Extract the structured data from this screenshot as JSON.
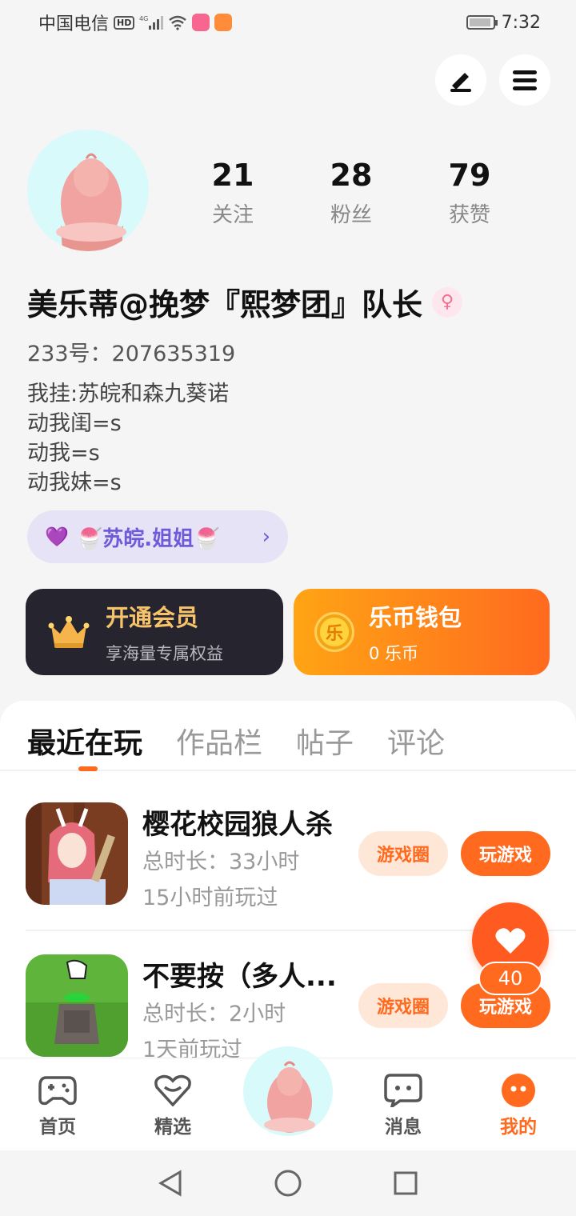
{
  "status_bar": {
    "carrier": "中国电信",
    "hd": "HD",
    "signal": "4G",
    "time": "7:32"
  },
  "profile": {
    "stats": [
      {
        "value": "21",
        "label": "关注"
      },
      {
        "value": "28",
        "label": "粉丝"
      },
      {
        "value": "79",
        "label": "获赞"
      }
    ],
    "username": "美乐蒂@挽梦『熙梦团』队长",
    "gender_symbol": "♀",
    "uid": "233号：207635319",
    "bio_lines": [
      "我挂:苏皖和森九葵诺",
      "动我闺=s",
      "动我=s",
      "动我妹=s"
    ],
    "couple": {
      "hearts": "💜",
      "name": "🍧苏皖.姐姐🍧",
      "chevron": "›"
    }
  },
  "cards": {
    "vip": {
      "title": "开通会员",
      "subtitle": "享海量专属权益"
    },
    "wallet": {
      "title": "乐币钱包",
      "subtitle": "0 乐币",
      "coin_char": "乐"
    }
  },
  "tabs": [
    {
      "label": "最近在玩",
      "active": true
    },
    {
      "label": "作品栏",
      "active": false
    },
    {
      "label": "帖子",
      "active": false
    },
    {
      "label": "评论",
      "active": false
    }
  ],
  "games": [
    {
      "name": "樱花校园狼人杀",
      "total_time": "总时长：33小时",
      "last_played": "15小时前玩过",
      "circle_label": "游戏圈",
      "play_label": "玩游戏"
    },
    {
      "name": "不要按（多人...",
      "total_time": "总时长：2小时",
      "last_played": "1天前玩过",
      "circle_label": "游戏圈",
      "play_label": "玩游戏"
    }
  ],
  "like_float": {
    "count": "40"
  },
  "bottom_nav": [
    {
      "label": "首页",
      "icon": "gamepad-icon",
      "active": false
    },
    {
      "label": "精选",
      "icon": "heart-chat-icon",
      "active": false
    },
    {
      "label": "消息",
      "icon": "message-icon",
      "active": false
    },
    {
      "label": "我的",
      "icon": "profile-face-icon",
      "active": true
    }
  ],
  "colors": {
    "accent": "#ff6a1f",
    "vip_gold": "#f6c36b",
    "couple_purple": "#6f5bd8",
    "avatar_bg": "#d9fafa"
  }
}
